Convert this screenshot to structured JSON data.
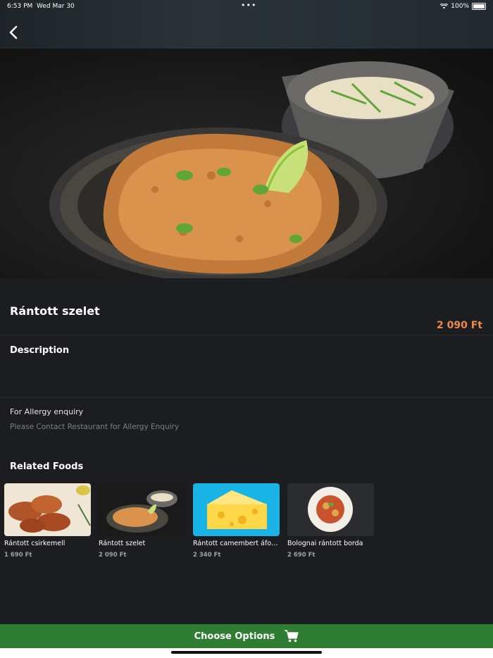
{
  "status_bar": {
    "time": "6:53 PM",
    "date": "Wed Mar 30",
    "battery": "100%"
  },
  "product": {
    "name": "Rántott szelet",
    "price": "2 090 Ft"
  },
  "description": {
    "heading": "Description",
    "text": ""
  },
  "allergy": {
    "label": "For Allergy enquiry",
    "text": "Please Contact Restaurant for Allergy Enquiry"
  },
  "related": {
    "heading": "Related Foods",
    "items": [
      {
        "name": "Rántott csirkemell",
        "price": "1 690 Ft"
      },
      {
        "name": "Rántott szelet",
        "price": "2 090 Ft"
      },
      {
        "name": "Rántott camembert  áfonya",
        "price": "2 340 Ft"
      },
      {
        "name": "Bolognai rántott borda",
        "price": "2 690 Ft"
      }
    ]
  },
  "cta": {
    "label": "Choose Options"
  },
  "colors": {
    "accent_price": "#ef8a45",
    "cta_green": "#2f7d32",
    "background": "#1c1d21"
  }
}
